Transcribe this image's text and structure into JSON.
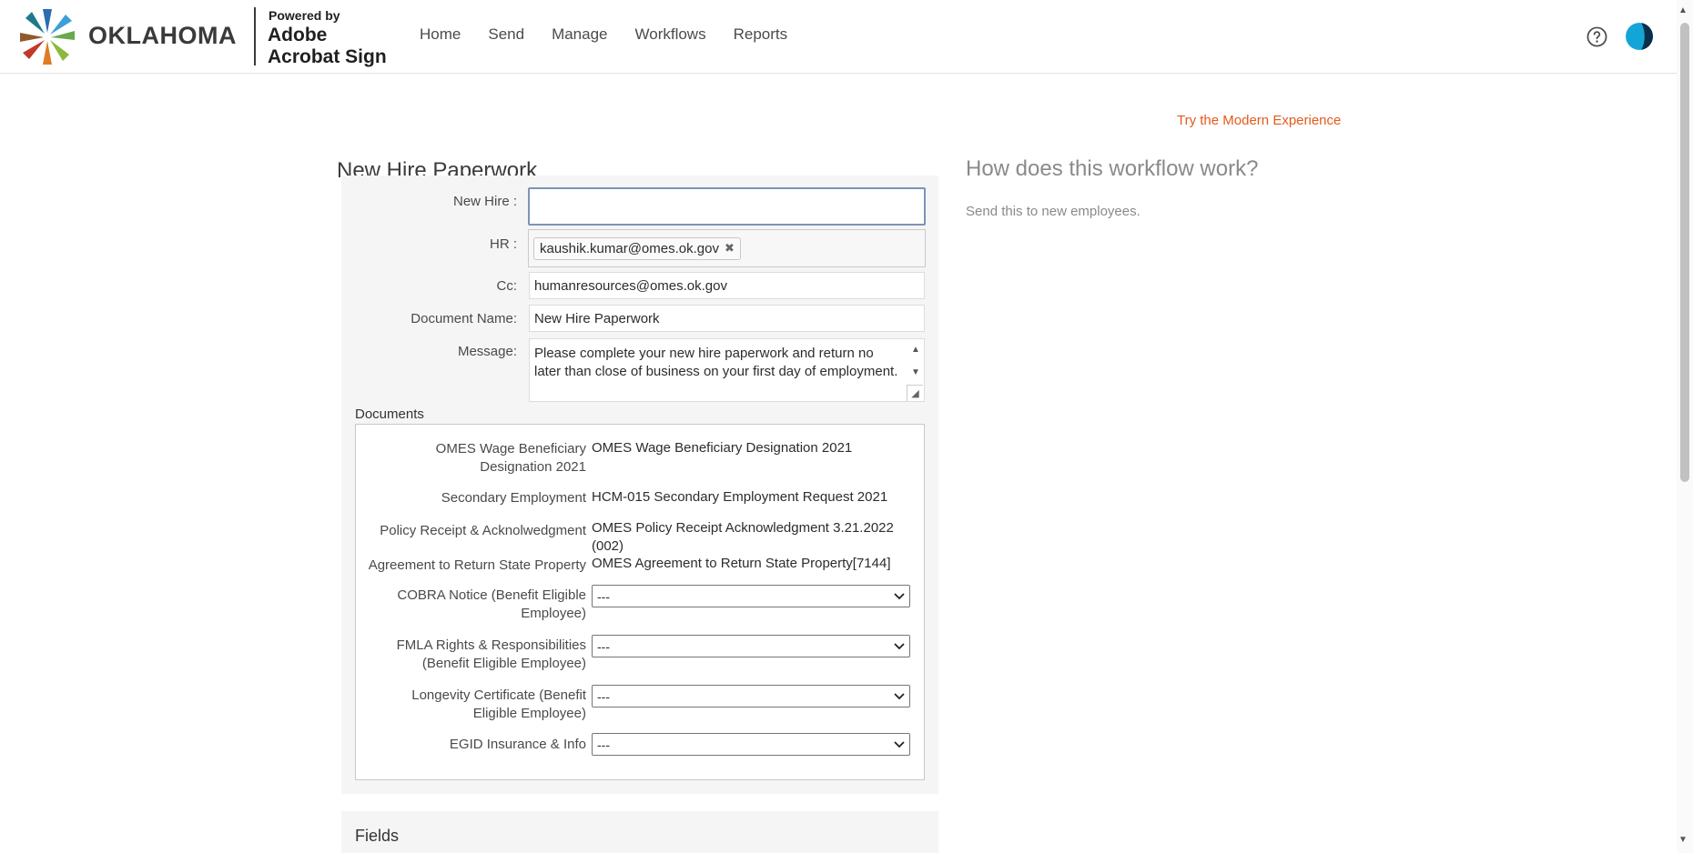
{
  "brand": {
    "state_name": "OKLAHOMA",
    "powered_by": "Powered by",
    "product_line1": "Adobe",
    "product_line2": "Acrobat Sign"
  },
  "nav": {
    "items": [
      "Home",
      "Send",
      "Manage",
      "Workflows",
      "Reports"
    ]
  },
  "header_icons": {
    "help": "help-icon",
    "avatar": "user-avatar"
  },
  "page": {
    "modern_link": "Try the Modern Experience",
    "title": "New Hire Paperwork"
  },
  "form": {
    "new_hire": {
      "label": "New Hire :",
      "value": ""
    },
    "hr": {
      "label": "HR :",
      "chip": "kaushik.kumar@omes.ok.gov"
    },
    "cc": {
      "label": "Cc:",
      "value": "humanresources@omes.ok.gov"
    },
    "document_name": {
      "label": "Document Name:",
      "value": "New Hire Paperwork"
    },
    "message": {
      "label": "Message:",
      "value": "Please complete your new hire paperwork and return no later than close of business on your first day of employment."
    }
  },
  "documents": {
    "title": "Documents",
    "rows": [
      {
        "label": "OMES Wage Beneficiary Designation 2021",
        "value": "OMES Wage Beneficiary Designation 2021"
      },
      {
        "label": "Secondary Employment",
        "value": "HCM-015 Secondary Employment Request 2021"
      },
      {
        "label": "Policy Receipt & Acknolwedgment",
        "value": "OMES Policy Receipt Acknowledgment 3.21.2022 (002)"
      },
      {
        "label": "Agreement to Return State Property",
        "value": "OMES Agreement to Return State Property[7144]"
      }
    ],
    "selects": [
      {
        "label": "COBRA Notice (Benefit Eligible Employee)",
        "value": "---"
      },
      {
        "label": "FMLA Rights & Responsibilities (Benefit Eligible Employee)",
        "value": "---"
      },
      {
        "label": "Longevity Certificate (Benefit Eligible Employee)",
        "value": "---"
      },
      {
        "label": "EGID Insurance & Info",
        "value": "---"
      }
    ]
  },
  "fields_section": {
    "title": "Fields"
  },
  "sidebar": {
    "heading": "How does this workflow work?",
    "text": "Send this to new employees."
  },
  "colors": {
    "accent_link": "#e5591b",
    "panel_bg": "#f5f5f5",
    "active_border": "#7d93b7"
  }
}
